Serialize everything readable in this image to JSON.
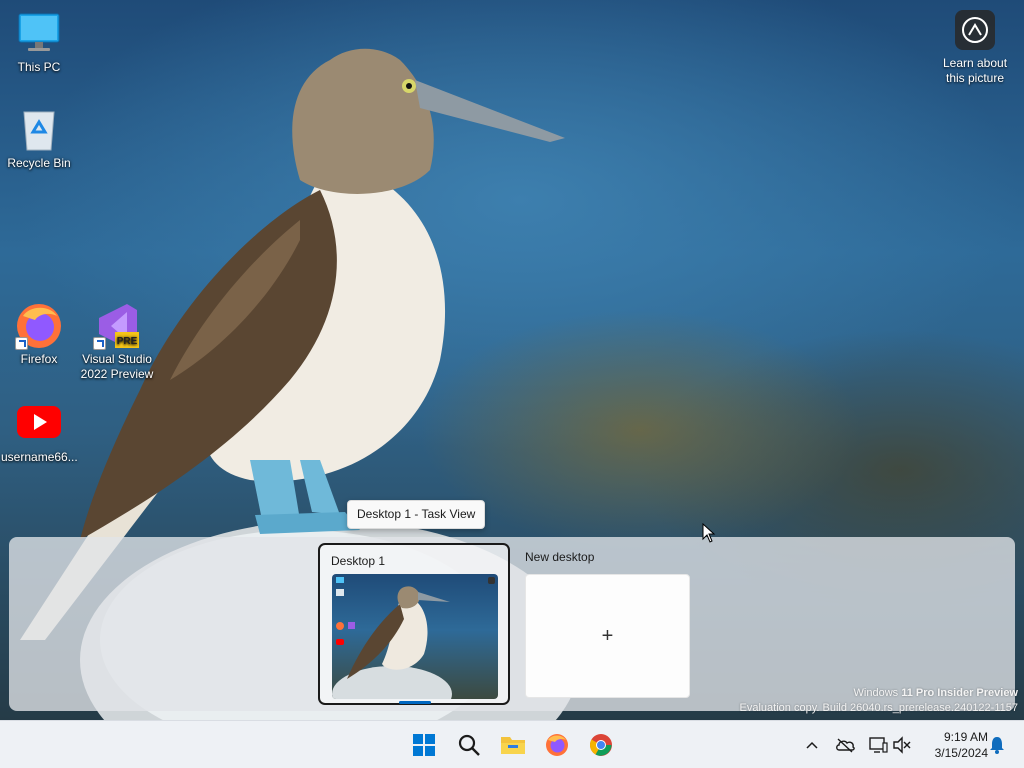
{
  "desktop_icons": [
    {
      "label": "This PC",
      "icon": "monitor-icon"
    },
    {
      "label": "Recycle Bin",
      "icon": "recycle-bin-icon"
    },
    {
      "label": "Firefox",
      "icon": "firefox-icon"
    },
    {
      "label": "Visual Studio 2022 Preview",
      "icon": "visual-studio-icon",
      "badge": "PRE"
    },
    {
      "label": "username66...",
      "icon": "youtube-icon"
    }
  ],
  "learn_picture": {
    "label": "Learn about this picture",
    "icon": "camera-icon"
  },
  "task_view": {
    "tooltip": "Desktop 1 - Task View",
    "desktops": [
      {
        "name": "Desktop 1",
        "active": true
      }
    ],
    "new_desktop_label": "New desktop",
    "add_symbol": "+"
  },
  "watermark": {
    "line1_prefix": "Windows ",
    "line1_bold": "11 Pro Insider Preview",
    "line2": "Evaluation copy. Build 26040.rs_prerelease.240122-1157"
  },
  "taskbar": {
    "apps": [
      "start-icon",
      "search-icon",
      "file-explorer-icon",
      "firefox-icon",
      "chrome-icon"
    ],
    "tray": [
      "chevron-up-icon",
      "onedrive-offline-icon",
      "network-icon",
      "volume-muted-icon",
      "notification-bell-icon"
    ],
    "time": "9:19 AM",
    "date": "3/15/2024"
  },
  "colors": {
    "accent": "#0067c0",
    "taskbar_bg": "#eef1f5"
  }
}
